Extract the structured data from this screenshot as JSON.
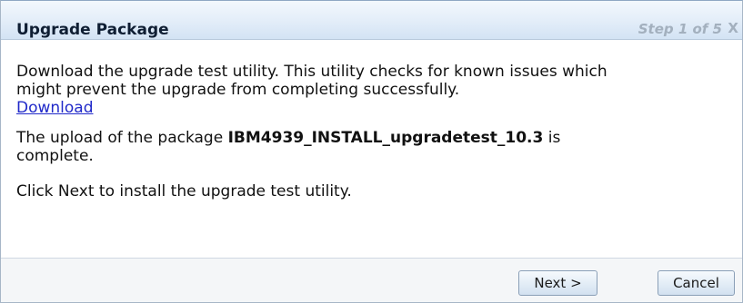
{
  "dialog": {
    "title": "Upgrade Package",
    "step_indicator": "Step 1 of 5",
    "close_glyph": "X"
  },
  "content": {
    "intro_line1": "Download the upgrade test utility. This utility checks for known issues which",
    "intro_line2": "might prevent the upgrade from completing successfully.",
    "download_link": "Download",
    "upload_prefix": "The upload of the package ",
    "package_name": "IBM4939_INSTALL_upgradetest_10.3",
    "upload_suffix_line1": " is",
    "upload_suffix_line2": "complete.",
    "instruction": "Click Next to install the upgrade test utility."
  },
  "buttons": {
    "next_label": "Next >",
    "cancel_label": "Cancel"
  },
  "colors": {
    "title_bar": "#dde9f6",
    "link": "#2029c9",
    "step_text": "#a3b0be"
  }
}
